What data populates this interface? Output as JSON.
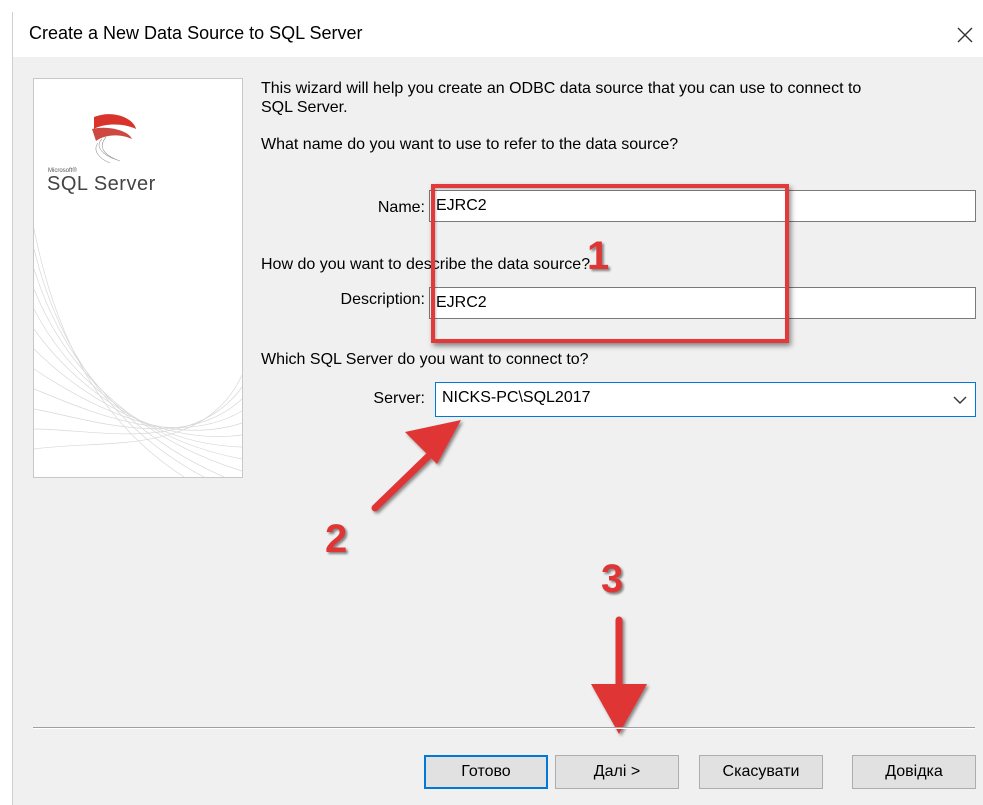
{
  "dialog": {
    "title": "Create a New Data Source to SQL Server",
    "logo_small": "Microsoft®",
    "logo_text": "SQL Server"
  },
  "wizard": {
    "intro": "This wizard will help you create an ODBC data source that you can use to connect to",
    "intro2": "SQL Server.",
    "name_question": "What name do you want to use to refer to the data source?",
    "name_label": "Name:",
    "name_value": "EJRC2",
    "desc_question": "How do you want to describe the data source?",
    "desc_label": "Description:",
    "desc_value": "EJRC2",
    "server_question": "Which SQL Server do you want to connect to?",
    "server_label": "Server:",
    "server_value": "NICKS-PC\\SQL2017"
  },
  "buttons": {
    "finish": "Готово",
    "next": "Далі >",
    "cancel": "Скасувати",
    "help": "Довідка"
  },
  "annotations": {
    "step1": "1",
    "step2": "2",
    "step3": "3",
    "color": "#e03535"
  }
}
